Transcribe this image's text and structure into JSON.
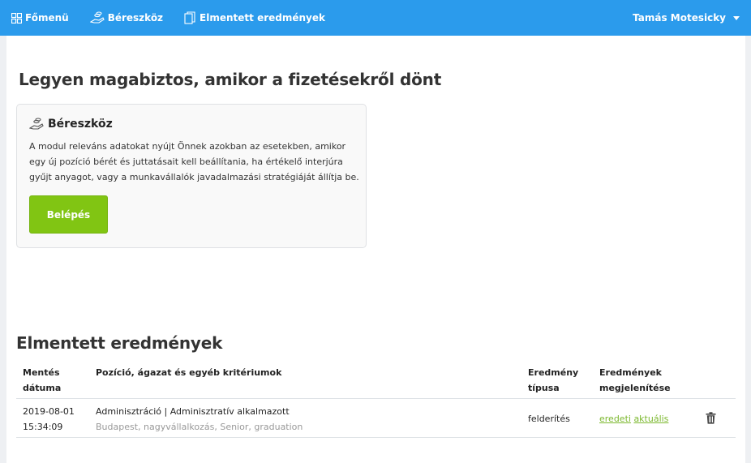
{
  "nav": {
    "items": [
      {
        "label": "Főmenü",
        "icon": "grid-icon"
      },
      {
        "label": "Béreszköz",
        "icon": "hand-coins-icon"
      },
      {
        "label": "Elmentett eredmények",
        "icon": "documents-icon"
      }
    ],
    "user": "Tamás Motesicky"
  },
  "main": {
    "title": "Legyen magabiztos, amikor a fizetésekről dönt",
    "card": {
      "title": "Béreszköz",
      "text": "A modul releváns adatokat nyújt Önnek azokban az esetekben, amikor egy új pozíció bérét és juttatásait kell beállítania, ha értékelő interjúra gyűjt anyagot, vagy a munkavállalók javadalmazási stratégiáját állítja be.",
      "button": "Belépés"
    }
  },
  "saved": {
    "title": "Elmentett eredmények",
    "headers": {
      "date_1": "Mentés",
      "date_2": "dátuma",
      "criteria": "Pozíció, ágazat és egyéb kritériumok",
      "type_1": "Eredmény",
      "type_2": "típusa",
      "view_1": "Eredmények",
      "view_2": "megjelenítése"
    },
    "rows": [
      {
        "date": "2019-08-01",
        "time": "15:34:09",
        "position": "Adminisztráció | Adminisztratív alkalmazott",
        "details": "Budapest, nagyvállalkozás, Senior, graduation",
        "type": "felderítés",
        "link_original": "eredeti",
        "link_current": "aktuális"
      }
    ]
  },
  "colors": {
    "navbar": "#2b9bec",
    "button": "#81c513",
    "link": "#7cb82f"
  }
}
